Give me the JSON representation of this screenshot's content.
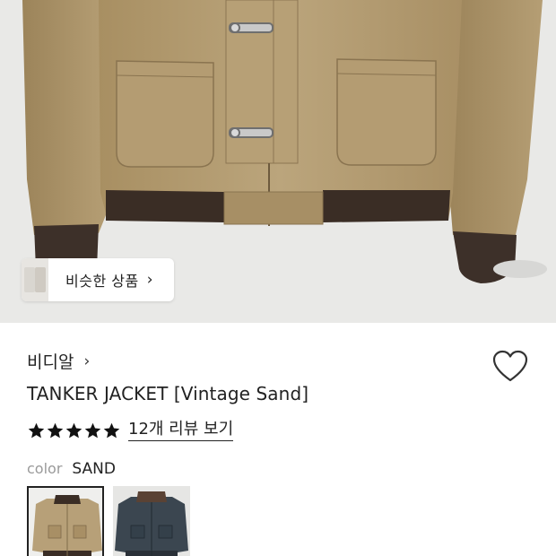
{
  "similar": {
    "label": "비슷한 상품"
  },
  "product": {
    "brand": "비디알",
    "title": "TANKER JACKET [Vintage Sand]",
    "rating": 5,
    "reviews_label": "12개 리뷰 보기",
    "color_label": "color",
    "color_value": "SAND"
  },
  "icons": {
    "chevron": "›",
    "heart": "heart-outline-icon",
    "star": "star-filled-icon"
  },
  "colors": {
    "jacket_sand": "#b9a37a",
    "rib_knit": "#3a2d25",
    "swatch_navy": "#3b4650"
  }
}
